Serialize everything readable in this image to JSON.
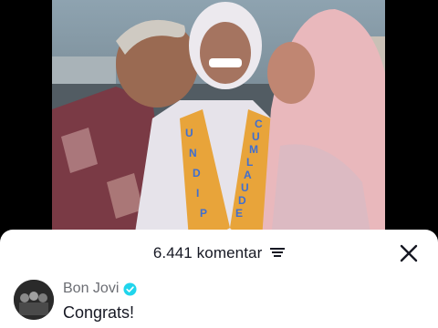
{
  "video": {
    "sash_left_text": "UNDIP",
    "sash_right_text": "CUMLAUDE"
  },
  "comments_sheet": {
    "count_label": "6.441 komentar",
    "sort_icon": "sort-lines-icon",
    "close_icon": "close-x-icon"
  },
  "comment": {
    "author": "Bon Jovi",
    "verified_icon": "verified-badge-icon",
    "verified_color": "#20d5ec",
    "text": "Congrats!"
  }
}
